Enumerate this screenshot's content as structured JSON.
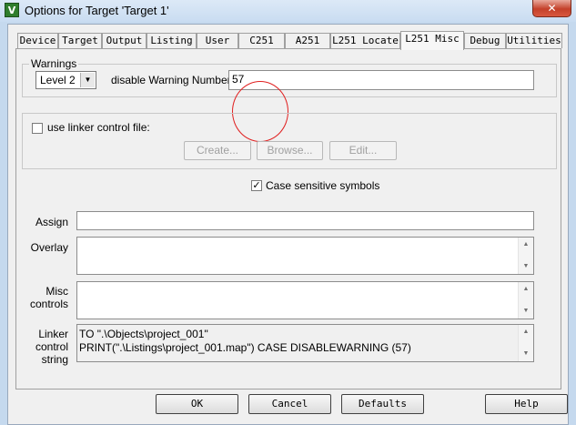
{
  "window": {
    "title": "Options for Target 'Target 1'",
    "icon_glyph": "V",
    "close_glyph": "✕"
  },
  "tabs": [
    {
      "label": "Device"
    },
    {
      "label": "Target"
    },
    {
      "label": "Output"
    },
    {
      "label": "Listing"
    },
    {
      "label": "User"
    },
    {
      "label": "C251"
    },
    {
      "label": "A251"
    },
    {
      "label": "L251 Locate"
    },
    {
      "label": "L251 Misc"
    },
    {
      "label": "Debug"
    },
    {
      "label": "Utilities"
    }
  ],
  "active_tab": "L251 Misc",
  "warnings": {
    "legend": "Warnings",
    "level_value": "Level 2",
    "disable_label": "disable Warning Numbers:",
    "disable_value": "57"
  },
  "linker_file": {
    "checkbox_label": "use linker control file:",
    "checked": false,
    "create_label": "Create...",
    "browse_label": "Browse...",
    "edit_label": "Edit..."
  },
  "case_sensitive": {
    "label": "Case sensitive symbols",
    "checked": true,
    "check_glyph": "✓"
  },
  "assign": {
    "label": "Assign",
    "value": ""
  },
  "overlay": {
    "label": "Overlay",
    "value": ""
  },
  "misc_controls": {
    "label_line1": "Misc",
    "label_line2": "controls",
    "value": ""
  },
  "linker_control_string": {
    "label_line1": "Linker",
    "label_line2": "control",
    "label_line3": "string",
    "line1": "TO \".\\Objects\\project_001\"",
    "line2": "PRINT(\".\\Listings\\project_001.map\") CASE DISABLEWARNING (57)"
  },
  "buttons": {
    "ok": "OK",
    "cancel": "Cancel",
    "defaults": "Defaults",
    "help": "Help"
  },
  "glyphs": {
    "dropdown": "▼",
    "scroll_up": "▲",
    "scroll_down": "▼"
  },
  "colors": {
    "annotation_circle": "#e02020",
    "close_button": "#c4402a"
  }
}
